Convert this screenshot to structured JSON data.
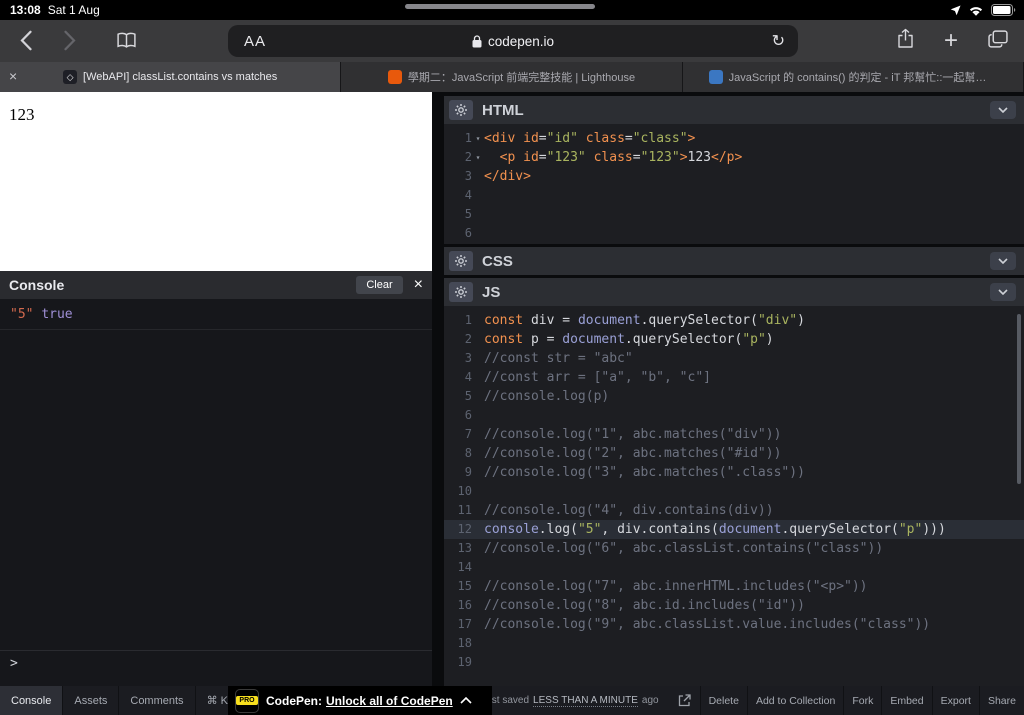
{
  "colors": {
    "kw": "#f2914f",
    "str": "#a9b45f",
    "comment": "#6d7280",
    "builtin": "#9aa0d6",
    "plain": "#d6d8dd",
    "console-string": "#d2694e",
    "console-bool": "#9f8fd6",
    "accent-yellow": "#f7df1e"
  },
  "status_bar": {
    "time": "13:08",
    "date": "Sat 1 Aug"
  },
  "browser": {
    "reader": "AA",
    "url": "codepen.io",
    "reload": "↻",
    "new_tab": "+"
  },
  "tabs": [
    {
      "title": "[WebAPI] classList.contains vs matches",
      "favicon_color": "#1e1f26",
      "active": true
    },
    {
      "title": "學期二：JavaScript 前端完整技能 | Lighthouse",
      "favicon_color": "#e8590c",
      "active": false
    },
    {
      "title": "JavaScript 的 contains() 的判定 - iT 邦幫忙::一起幫忙解決…",
      "favicon_color": "#3b77c2",
      "active": false
    }
  ],
  "preview": {
    "text": "123"
  },
  "console": {
    "title": "Console",
    "clear": "Clear",
    "close": "×",
    "entries": [
      {
        "string": "\"5\"",
        "value": "true"
      }
    ],
    "prompt": ">"
  },
  "editors": {
    "html": {
      "title": "HTML",
      "lines": [
        {
          "n": 1,
          "fold": true,
          "tokens": [
            [
              "k",
              "<div"
            ],
            [
              "p",
              " "
            ],
            [
              "a",
              "id"
            ],
            [
              "o",
              "="
            ],
            [
              "s",
              "\"id\""
            ],
            [
              "p",
              " "
            ],
            [
              "a",
              "class"
            ],
            [
              "o",
              "="
            ],
            [
              "s",
              "\"class\""
            ],
            [
              "k",
              ">"
            ]
          ]
        },
        {
          "n": 2,
          "fold": true,
          "tokens": [
            [
              "p",
              "  "
            ],
            [
              "k",
              "<p"
            ],
            [
              "p",
              " "
            ],
            [
              "a",
              "id"
            ],
            [
              "o",
              "="
            ],
            [
              "s",
              "\"123\""
            ],
            [
              "p",
              " "
            ],
            [
              "a",
              "class"
            ],
            [
              "o",
              "="
            ],
            [
              "s",
              "\"123\""
            ],
            [
              "k",
              ">"
            ],
            [
              "t",
              "123"
            ],
            [
              "k",
              "</p>"
            ]
          ]
        },
        {
          "n": 3,
          "tokens": [
            [
              "k",
              "</div>"
            ]
          ]
        },
        {
          "n": 4,
          "tokens": []
        },
        {
          "n": 5,
          "tokens": []
        },
        {
          "n": 6,
          "tokens": []
        }
      ]
    },
    "css": {
      "title": "CSS"
    },
    "js": {
      "title": "JS",
      "lines": [
        {
          "n": 1,
          "tokens": [
            [
              "k",
              "const"
            ],
            [
              "p",
              " div "
            ],
            [
              "o",
              "="
            ],
            [
              "p",
              " "
            ],
            [
              "b",
              "document"
            ],
            [
              "p",
              ".querySelector("
            ],
            [
              "s",
              "\"div\""
            ],
            [
              "p",
              ")"
            ]
          ]
        },
        {
          "n": 2,
          "tokens": [
            [
              "k",
              "const"
            ],
            [
              "p",
              " p "
            ],
            [
              "o",
              "="
            ],
            [
              "p",
              " "
            ],
            [
              "b",
              "document"
            ],
            [
              "p",
              ".querySelector("
            ],
            [
              "s",
              "\"p\""
            ],
            [
              "p",
              ")"
            ]
          ]
        },
        {
          "n": 3,
          "tokens": [
            [
              "c",
              "//const str = \"abc\""
            ]
          ]
        },
        {
          "n": 4,
          "tokens": [
            [
              "c",
              "//const arr = [\"a\", \"b\", \"c\"]"
            ]
          ]
        },
        {
          "n": 5,
          "tokens": [
            [
              "c",
              "//console.log(p)"
            ]
          ]
        },
        {
          "n": 6,
          "tokens": []
        },
        {
          "n": 7,
          "tokens": [
            [
              "c",
              "//console.log(\"1\", abc.matches(\"div\"))"
            ]
          ]
        },
        {
          "n": 8,
          "tokens": [
            [
              "c",
              "//console.log(\"2\", abc.matches(\"#id\"))"
            ]
          ]
        },
        {
          "n": 9,
          "tokens": [
            [
              "c",
              "//console.log(\"3\", abc.matches(\".class\"))"
            ]
          ]
        },
        {
          "n": 10,
          "tokens": []
        },
        {
          "n": 11,
          "tokens": [
            [
              "c",
              "//console.log(\"4\", div.contains(div))"
            ]
          ]
        },
        {
          "n": 12,
          "active": true,
          "tokens": [
            [
              "b",
              "console"
            ],
            [
              "p",
              ".log("
            ],
            [
              "s",
              "\"5\""
            ],
            [
              "p",
              ", div.contains("
            ],
            [
              "b",
              "document"
            ],
            [
              "p",
              ".querySelector("
            ],
            [
              "s",
              "\"p\""
            ],
            [
              "p",
              ")))"
            ]
          ]
        },
        {
          "n": 13,
          "tokens": [
            [
              "c",
              "//console.log(\"6\", abc.classList.contains(\"class\"))"
            ]
          ]
        },
        {
          "n": 14,
          "tokens": []
        },
        {
          "n": 15,
          "tokens": [
            [
              "c",
              "//console.log(\"7\", abc.innerHTML.includes(\"<p>\"))"
            ]
          ]
        },
        {
          "n": 16,
          "tokens": [
            [
              "c",
              "//console.log(\"8\", abc.id.includes(\"id\"))"
            ]
          ]
        },
        {
          "n": 17,
          "tokens": [
            [
              "c",
              "//console.log(\"9\", abc.classList.value.includes(\"class\"))"
            ]
          ]
        },
        {
          "n": 18,
          "tokens": []
        },
        {
          "n": 19,
          "tokens": []
        }
      ]
    }
  },
  "footer": {
    "left_buttons": [
      "Console",
      "Assets",
      "Comments",
      "⌘ Keys"
    ],
    "pro_label": "PRO",
    "banner_prefix": "CodePen:",
    "banner_link": "Unlock all of CodePen",
    "saved_prefix": "Last saved",
    "saved_highlight": "LESS THAN A MINUTE",
    "saved_suffix": "ago",
    "right_buttons": [
      "Delete",
      "Add to Collection",
      "Fork",
      "Embed",
      "Export",
      "Share"
    ]
  }
}
